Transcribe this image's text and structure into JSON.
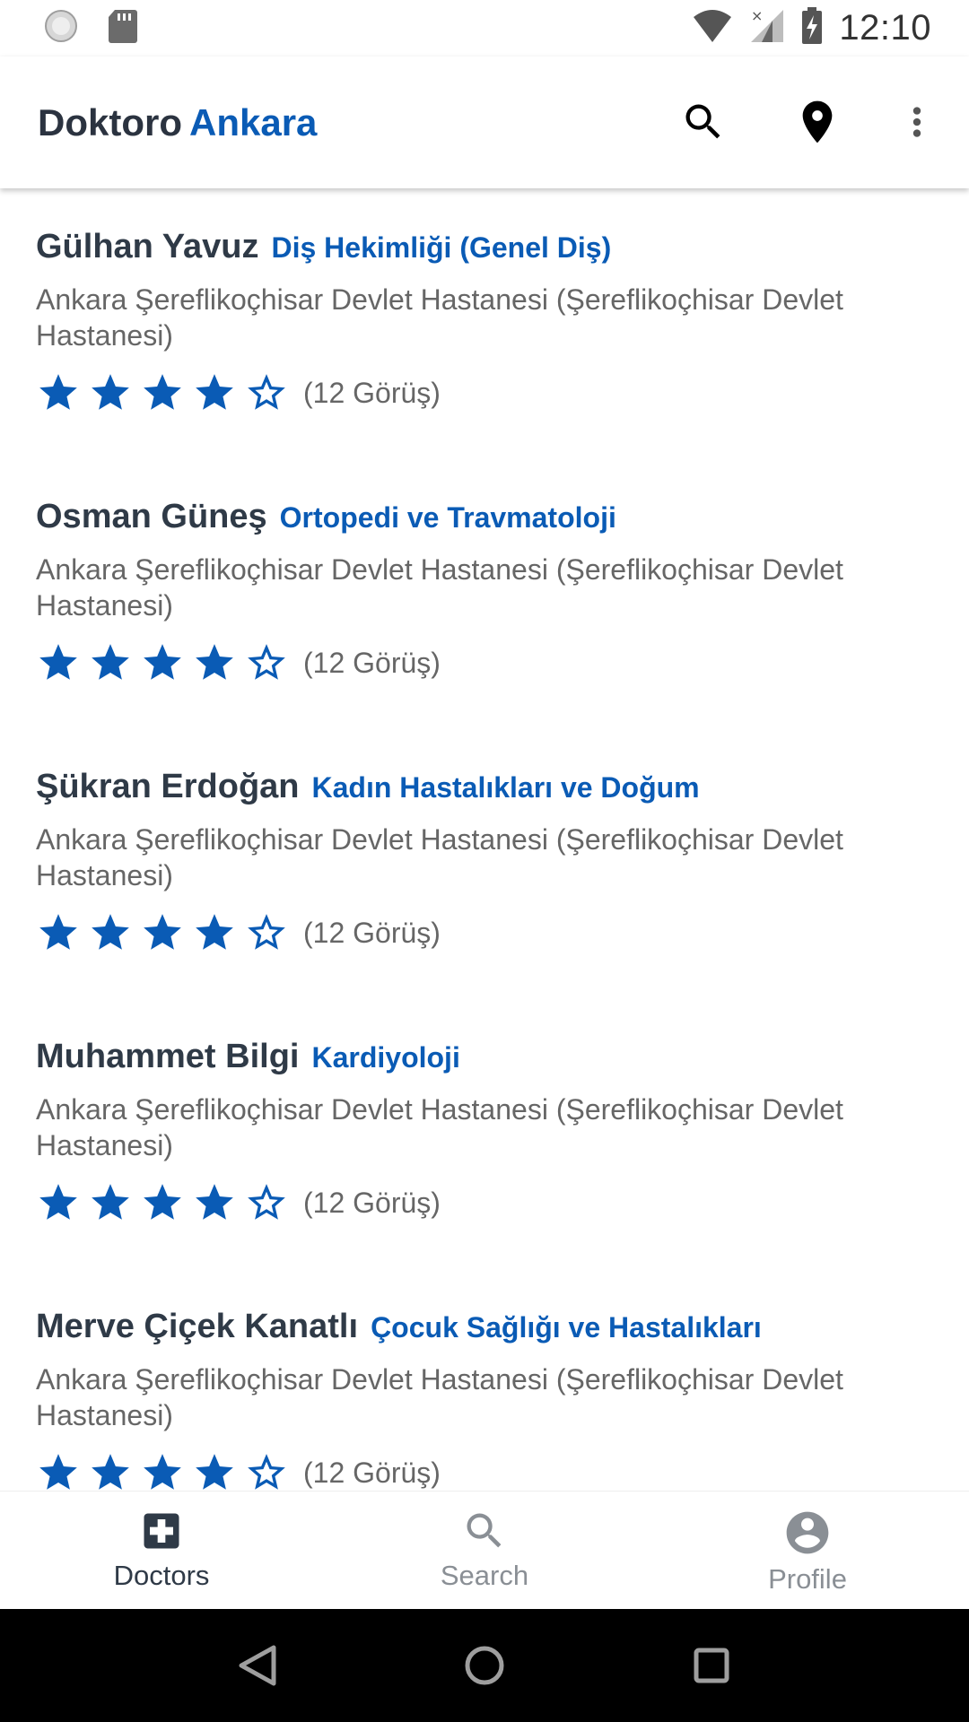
{
  "status_bar": {
    "time": "12:10"
  },
  "app_bar": {
    "title_part1": "Doktoro",
    "title_part2": "Ankara"
  },
  "colors": {
    "accent": "#0a5bb5",
    "name_text": "#2f3a47",
    "secondary_text": "#666666"
  },
  "doctors": [
    {
      "name": "Gülhan Yavuz",
      "specialty": "Diş Hekimliği (Genel Diş)",
      "hospital": "Ankara Şereflikoçhisar Devlet Hastanesi (Şereflikoçhisar Devlet Hastanesi)",
      "rating": 4,
      "max_rating": 5,
      "reviews": "(12 Görüş)"
    },
    {
      "name": "Osman Güneş",
      "specialty": "Ortopedi ve Travmatoloji",
      "hospital": "Ankara Şereflikoçhisar Devlet Hastanesi (Şereflikoçhisar Devlet Hastanesi)",
      "rating": 4,
      "max_rating": 5,
      "reviews": "(12 Görüş)"
    },
    {
      "name": "Şükran Erdoğan",
      "specialty": "Kadın Hastalıkları ve Doğum",
      "hospital": "Ankara Şereflikoçhisar Devlet Hastanesi (Şereflikoçhisar Devlet Hastanesi)",
      "rating": 4,
      "max_rating": 5,
      "reviews": "(12 Görüş)"
    },
    {
      "name": "Muhammet Bilgi",
      "specialty": "Kardiyoloji",
      "hospital": "Ankara Şereflikoçhisar Devlet Hastanesi (Şereflikoçhisar Devlet Hastanesi)",
      "rating": 4,
      "max_rating": 5,
      "reviews": "(12 Görüş)"
    },
    {
      "name": "Merve Çiçek Kanatlı",
      "specialty": "Çocuk Sağlığı ve Hastalıkları",
      "hospital": "Ankara Şereflikoçhisar Devlet Hastanesi (Şereflikoçhisar Devlet Hastanesi)",
      "rating": 4,
      "max_rating": 5,
      "reviews": "(12 Görüş)"
    }
  ],
  "bottom_nav": {
    "items": [
      {
        "label": "Doctors",
        "icon": "medical-cross-icon",
        "active": true
      },
      {
        "label": "Search",
        "icon": "search-icon",
        "active": false
      },
      {
        "label": "Profile",
        "icon": "account-circle-icon",
        "active": false
      }
    ]
  }
}
